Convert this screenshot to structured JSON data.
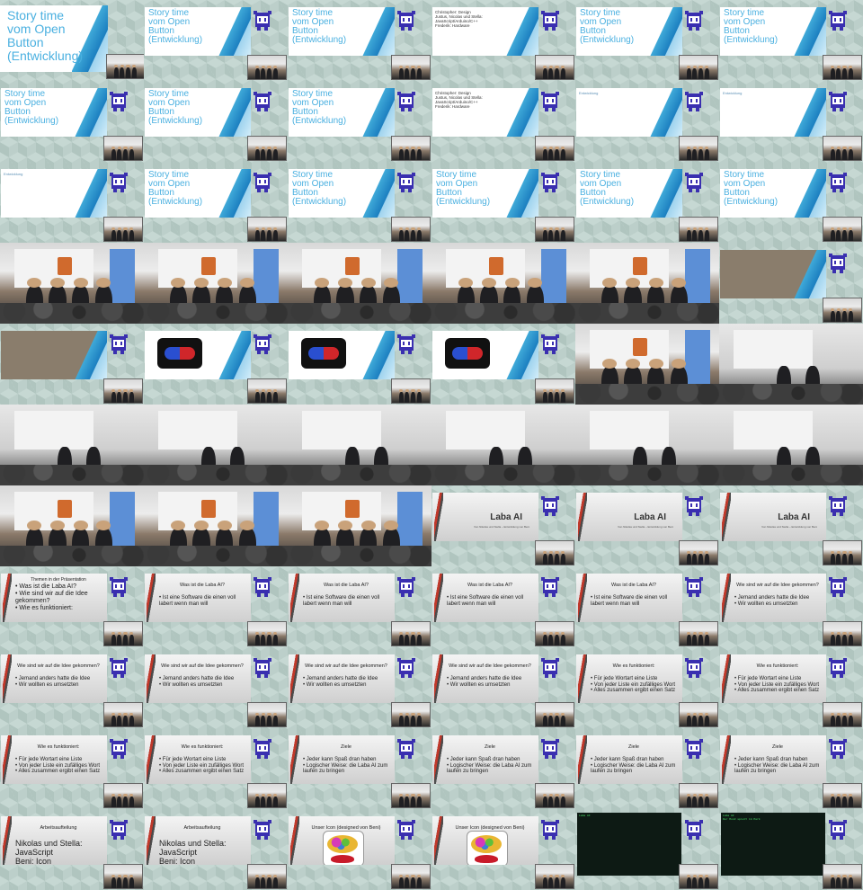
{
  "blue_slides": {
    "title_line1": "Story time",
    "title_line2": "vom Open",
    "title_line3": "Button",
    "title_line4": "(Entwicklung)",
    "team_heading": "Aufgabenverteilung",
    "team_lines": [
      "Christopher: Design",
      "Justus, Nicolas und Stella: JavaScript/Arduino/C++",
      "Frederik: Hardware"
    ],
    "dev_heading": "Entwicklung"
  },
  "gray_slides": {
    "laba_title": "Laba AI",
    "laba_sub": "Von Nikolas und Stella – Entwicklung von Beni",
    "toc_title": "Themen in der Präsentation",
    "toc_items": [
      "Was ist die Laba AI?",
      "Wie sind wir auf die Idee gekommen?",
      "Wie es funktioniert:"
    ],
    "what_title": "Was ist die Laba AI?",
    "what_items": [
      "Ist eine Software die einen voll labert wenn man will"
    ],
    "idea_title": "Wie sind wir auf die Idee gekommen?",
    "idea_items": [
      "Jemand anders hatte die Idee",
      "Wir wollten es umsetzten"
    ],
    "how_title": "Wie es funktioniert:",
    "how_items": [
      "Für jede Wortart eine Liste",
      "Von jeder Liste ein zufälliges Wort",
      "Alles zusammen ergibt einen Satz"
    ],
    "goals_title": "Ziele",
    "goals_items": [
      "Jeder kann Spaß dran haben",
      "Logischer Weise: die Laba AI zum laufen zu bringen"
    ],
    "work_title": "Arbeitsaufteilung",
    "work_items": [
      "Nikolas und Stella: JavaScript",
      "Beni: Icon"
    ],
    "icon_title": "Unser Icon (designed von Beni)"
  },
  "terminal": {
    "lines_a": [
      "Laba AI"
    ],
    "lines_b": [
      "Laba AI",
      "Der Hund spielt im Park"
    ],
    "lines_c": [
      "Laba AI",
      "Der Hund spielt im Park",
      "Ein Vogel fliegt über den Baum",
      "Die Katze schläft"
    ]
  },
  "colors": {
    "accent_blue": "#4ab0e0",
    "mascot": "#3a2fb0",
    "slide_red": "#c0392b",
    "terminal_green": "#4be06a"
  },
  "icons": {
    "mascot": "robot-mascot-icon"
  }
}
